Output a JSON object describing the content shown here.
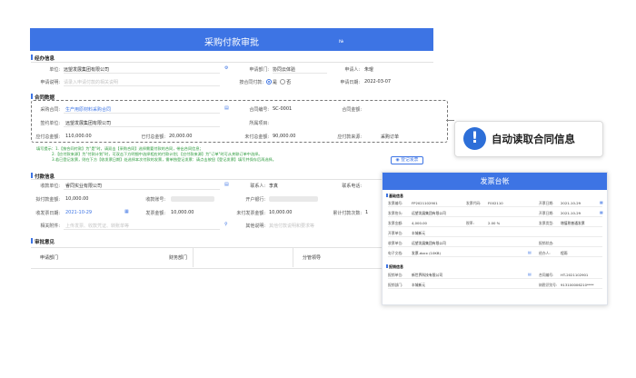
{
  "title": "采购付款审批",
  "title_no": "№",
  "sections": {
    "basic": "经办信息",
    "contract": "合同数据",
    "payment": "付款信息",
    "review": "审批意见"
  },
  "basic": {
    "unit_label": "单位:",
    "unit_value": "远望发展集团有限公司",
    "dept_label": "申请部门:",
    "dept_value": "协同云体验",
    "applicant_label": "申请人:",
    "applicant_value": "朱琨",
    "desc_label": "申请说明:",
    "desc_placeholder": "请录入申请付款的相关说明",
    "contract_pay_label": "按合同付款:",
    "yes": "是",
    "no": "否",
    "date_label": "申请日期:",
    "date_value": "2022-03-07"
  },
  "contract": {
    "name_label": "采购合同:",
    "name_value": "生产用原材料采购合同",
    "code_label": "合同编号:",
    "code_value": "SC-0001",
    "amount_label": "合同金额:",
    "amount_value": "",
    "party_label": "签约单位:",
    "party_value": "远望发展集团有限公司",
    "project_label": "所属项目:",
    "project_value": "",
    "payable_label": "应付总金额:",
    "payable_value": "110,000.00",
    "paid_label": "已付总金额:",
    "paid_value": "20,000.00",
    "unpaid_label": "未付总金额:",
    "unpaid_value": "90,000.00",
    "source_label": "应付款来源:",
    "source_value": "采购订单"
  },
  "notes": [
    "填写提示：1.【按合同付款】为\"是\"时，请双击【采购合同】选择需要付款的合同，带出合同信息；",
    "2.【应付款来源】为\"付款计划\"时，可双击下方明细中选择相应的付款计划；【应付款来源】为\"订单\"时可从关联订单中选择。",
    "3.若已登记发票，则在下方【收发票日期】处选择本次付款的发票，需单独登记发票：请点击按钮【登记发票】填写并保存后再选择。"
  ],
  "invoice_btn": "登记发票",
  "payment": {
    "payee_label": "收款单位:",
    "payee_value": "睿同实业有限公司",
    "contact_label": "联系人:",
    "contact_value": "李真",
    "phone_label": "联系电话:",
    "planned_label": "拟付款金额:",
    "planned_value": "10,000.00",
    "account_label": "收款账号:",
    "bank_label": "开户银行:",
    "invdate_label": "收发票日期:",
    "invdate_value": "2021-10-29",
    "invamt_label": "发票金额:",
    "invamt_value": "10,000.00",
    "unpaid_label": "未付发票金额:",
    "unpaid_value": "10,000.00",
    "count_label": "累计付款次数:",
    "count_value": "1",
    "attach_label": "相关附件:",
    "attach_placeholder": "上传发票、收款凭证、转账单等",
    "other_label": "其他说明:",
    "other_placeholder": "其他付款说明和要求等"
  },
  "review": {
    "col1": "申请部门",
    "col2": "财务部门",
    "col3": "分管领导"
  },
  "callout": {
    "icon": "!",
    "text": "自动读取合同信息"
  },
  "panel": {
    "title": "发票台帐",
    "sec1": "基础信息",
    "sec2": "报销信息",
    "rows": [
      {
        "l1": "发票编号:",
        "v1": "FP2021102901",
        "l2": "发票代码:",
        "v2": "F002110",
        "l3": "开票日期:",
        "v3": "2021-10-29"
      },
      {
        "l1": "发票抬头:",
        "v1": "远望发展集团有限公司",
        "l2": "",
        "v2": "",
        "l3": "开票日期:",
        "v3": "2021-10-29"
      },
      {
        "l1": "发票金额:",
        "v1": "4,000.00",
        "l2": "税率:",
        "v2": "2.00 %",
        "l3": "发票类型:",
        "v3": "增值税普通发票"
      },
      {
        "l1": "开票单位:",
        "v1": "丰城新元",
        "l2": "",
        "v2": "",
        "l3": "",
        "v3": ""
      },
      {
        "l1": "收票单位:",
        "v1": "远望发展集团有限公司",
        "l2": "",
        "v2": "",
        "l3": "报销状态:",
        "v3": ""
      },
      {
        "l1": "电子文档:",
        "v1": "发票.docx (10KB)",
        "l2": "",
        "v2": "",
        "l3": "经办人:",
        "v3": "程雨"
      }
    ],
    "rows2": [
      {
        "l1": "报销单位:",
        "v1": "新世界科技有限公司",
        "l2": "",
        "v2": "",
        "l3": "合同编号:",
        "v3": "HT-2021102901"
      },
      {
        "l1": "报销部门:",
        "v1": "丰城新元",
        "l2": "",
        "v2": "",
        "l3": "纳税识别号:",
        "v3": "913100006210****"
      }
    ]
  },
  "colors": {
    "accent": "#3d74e4",
    "note_green": "#2a9a3a"
  }
}
